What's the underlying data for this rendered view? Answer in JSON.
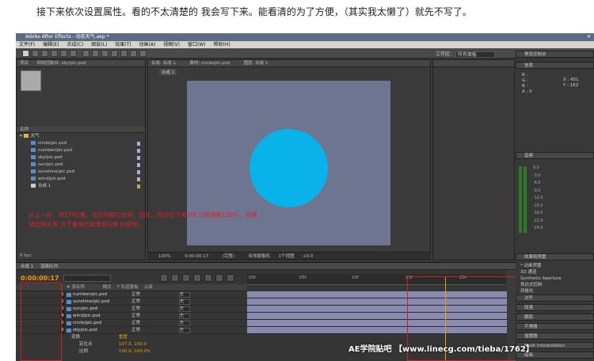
{
  "caption": "接下来依次设置属性。看的不太清楚的 我会写下来。能看清的为了方便，（其实我太懒了）就先不写了。",
  "window": {
    "title": "Adobe After Effects - 动态天气.aep *"
  },
  "menu": [
    "文件(F)",
    "编辑(E)",
    "合成(C)",
    "图层(L)",
    "效果(T)",
    "动画(A)",
    "视图(V)",
    "窗口(W)",
    "帮助(H)"
  ],
  "toolbar": {
    "workspace_label": "工作区:",
    "workspace_value": "所有面板"
  },
  "project_panel": {
    "tab": "项目",
    "effects_tab": "特效控制台: sky/pic.psd",
    "search_header": "名称",
    "folder": "天气",
    "items": [
      {
        "name": "circle/pic.psd",
        "color": "#b6a8e0"
      },
      {
        "name": "number/pic.psd",
        "color": "#b6a8e0"
      },
      {
        "name": "sky/pic.psd",
        "color": "#b6a8e0"
      },
      {
        "name": "sun/pic.psd",
        "color": "#b6a8e0"
      },
      {
        "name": "sunshine/pic.psd",
        "color": "#b6a8e0"
      },
      {
        "name": "wind/pic.psd",
        "color": "#b6a8e0"
      },
      {
        "name": "合成 1",
        "color": "#c9a34a"
      }
    ],
    "footer": "8 bpc"
  },
  "composition_panel": {
    "tab": "合成: 合成 1",
    "footage_tab": "素材: circle/pic.psd",
    "layer_tab": "图层: 合成 1",
    "crumb": "合成 1",
    "zoom": "100%",
    "timecode": "0:00:00:17",
    "resolution": "(完整)",
    "camera": "有效摄像机",
    "views": "1个视图",
    "offset": "+0.0"
  },
  "annotation": "从上一步，到17f位置。在比例那打比例，回车。然后往下来20f 比例调整100%。关键帧比例关系 为了看得出效果有Q弹 的感觉。",
  "timeline": {
    "tabs": [
      "合成 1",
      "渲染队列"
    ],
    "timecode": "0:00:00:17",
    "column_header": "# 源名称",
    "mode_header": "模式",
    "trkmat_header": "T 轨道蒙板",
    "parent_header": "父级",
    "ruler_ticks": [
      "00f",
      "05f",
      "10f",
      "15f",
      "20f"
    ],
    "layers": [
      {
        "num": "1",
        "name": "number/pic.psd",
        "mode": "正常",
        "parent": "无"
      },
      {
        "num": "2",
        "name": "sunshine/pic.psd",
        "mode": "正常",
        "parent": "无"
      },
      {
        "num": "3",
        "name": "sun/pic.psd",
        "mode": "正常",
        "parent": "无"
      },
      {
        "num": "4",
        "name": "wind/pic.psd",
        "mode": "正常",
        "parent": "无"
      },
      {
        "num": "5",
        "name": "circle/pic.psd",
        "mode": "正常",
        "parent": "无"
      },
      {
        "num": "6",
        "name": "sky/pic.psd",
        "mode": "正常",
        "parent": "无"
      }
    ],
    "properties": [
      {
        "label": "变换",
        "value": "重置"
      },
      {
        "label": "定位点",
        "value": "107.5, 100.0"
      },
      {
        "label": "比例",
        "value": "100.0, 100.0%"
      }
    ]
  },
  "right_panel": {
    "info_tab": "信息",
    "preview_tab": "预览控制台",
    "info_values": {
      "r": "R :",
      "g": "G :",
      "b": "B :",
      "a": "A : 0",
      "x": "X : 451",
      "y": "Y : 162"
    },
    "audio_tab": "音频",
    "audio_scale": [
      "0.0",
      "-3.0",
      "-6.0",
      "-9.0",
      "-12.0",
      "-15.0",
      "-18.0",
      "-21.0",
      "-24.0"
    ],
    "effects_tab": "效果和预置",
    "effects_items": [
      "* 动画预置",
      "3D 通道",
      "Synthetic Aperture",
      "表达式控制",
      "风格化"
    ],
    "align_tab": "对齐",
    "paragraph_tab": "段落",
    "tracker_tab": "跟踪",
    "smoother_tab": "平滑器",
    "wiggler_tab": "摇摆器",
    "mask_tab": "Mask Interpolation",
    "paint_tab": "绘画",
    "brushes_tab": "笔刷"
  },
  "watermark": "AE学院贴吧 【www.linecg.com/tieba/1762】"
}
